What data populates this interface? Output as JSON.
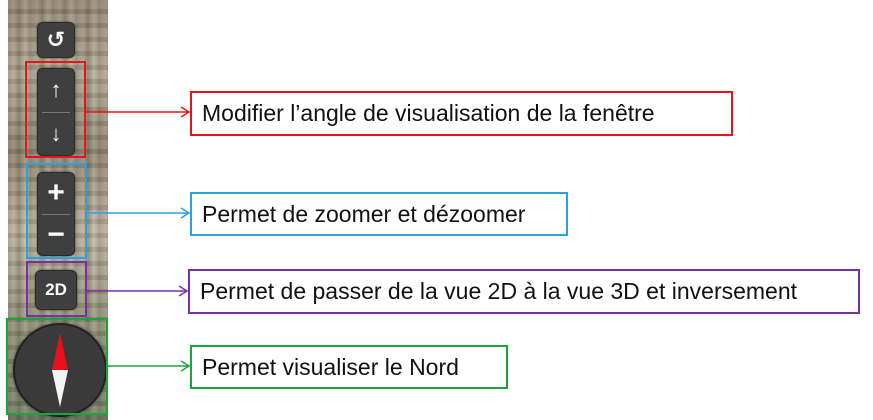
{
  "controls": {
    "reset_glyph": "↺",
    "tilt_up_glyph": "↑",
    "tilt_down_glyph": "↓",
    "zoom_in_glyph": "+",
    "zoom_out_glyph": "−",
    "view_mode_label": "2D"
  },
  "annotations": {
    "tilt": "Modifier l’angle de visualisation de la fenêtre",
    "zoom": "Permet de zoomer et dézoomer",
    "view_mode": "Permet de passer de la vue 2D à la vue 3D et inversement",
    "compass": "Permet visualiser le Nord"
  },
  "colors": {
    "tilt": "#e8141c",
    "zoom": "#2ea0df",
    "view_mode": "#7b2fa5",
    "compass": "#18a63c"
  }
}
